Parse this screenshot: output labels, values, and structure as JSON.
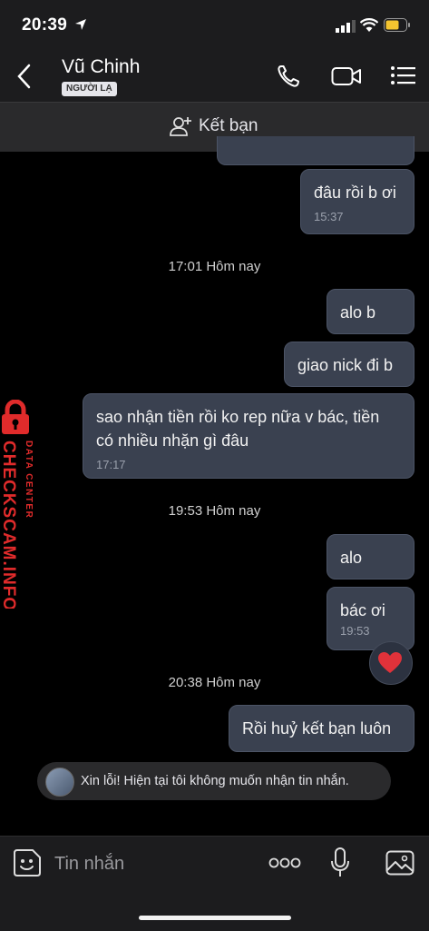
{
  "status_bar": {
    "time": "20:39"
  },
  "header": {
    "contact_name": "Vũ Chinh",
    "badge": "NGƯỜI LẠ"
  },
  "add_friend": {
    "label": "Kết bạn"
  },
  "messages": [
    {
      "text": "đâu rồi b ơi",
      "time": "15:37"
    },
    {
      "text": "alo b"
    },
    {
      "text": "giao nick đi b"
    },
    {
      "text": "sao nhận tiền rồi ko rep nữa v bác, tiền có nhiều nhặn gì đâu",
      "time": "17:17"
    },
    {
      "text": "alo"
    },
    {
      "text": "bác ơi",
      "time": "19:53"
    },
    {
      "text": "Rồi huỷ kết bạn luôn"
    }
  ],
  "separators": [
    "17:01 Hôm nay",
    "19:53 Hôm nay",
    "20:38 Hôm nay"
  ],
  "notice": {
    "text": "Xin lỗi! Hiện tại tôi không muốn nhận tin nhắn."
  },
  "composer": {
    "placeholder": "Tin nhắn"
  },
  "watermark": {
    "line1": "DATA CENTER",
    "line2": "CHECKSCAM.INFO"
  },
  "icons": [
    "location-arrow-icon",
    "signal-icon",
    "wifi-icon",
    "battery-icon",
    "back-icon",
    "phone-icon",
    "video-call-icon",
    "menu-icon",
    "add-friend-icon",
    "heart-reaction-icon",
    "sticker-icon",
    "more-icon",
    "microphone-icon",
    "image-icon",
    "lock-icon"
  ],
  "colors": {
    "bubble": "#3a4150",
    "battery": "#f4c430",
    "heart": "#e0323a",
    "watermark": "#e02b2b"
  }
}
